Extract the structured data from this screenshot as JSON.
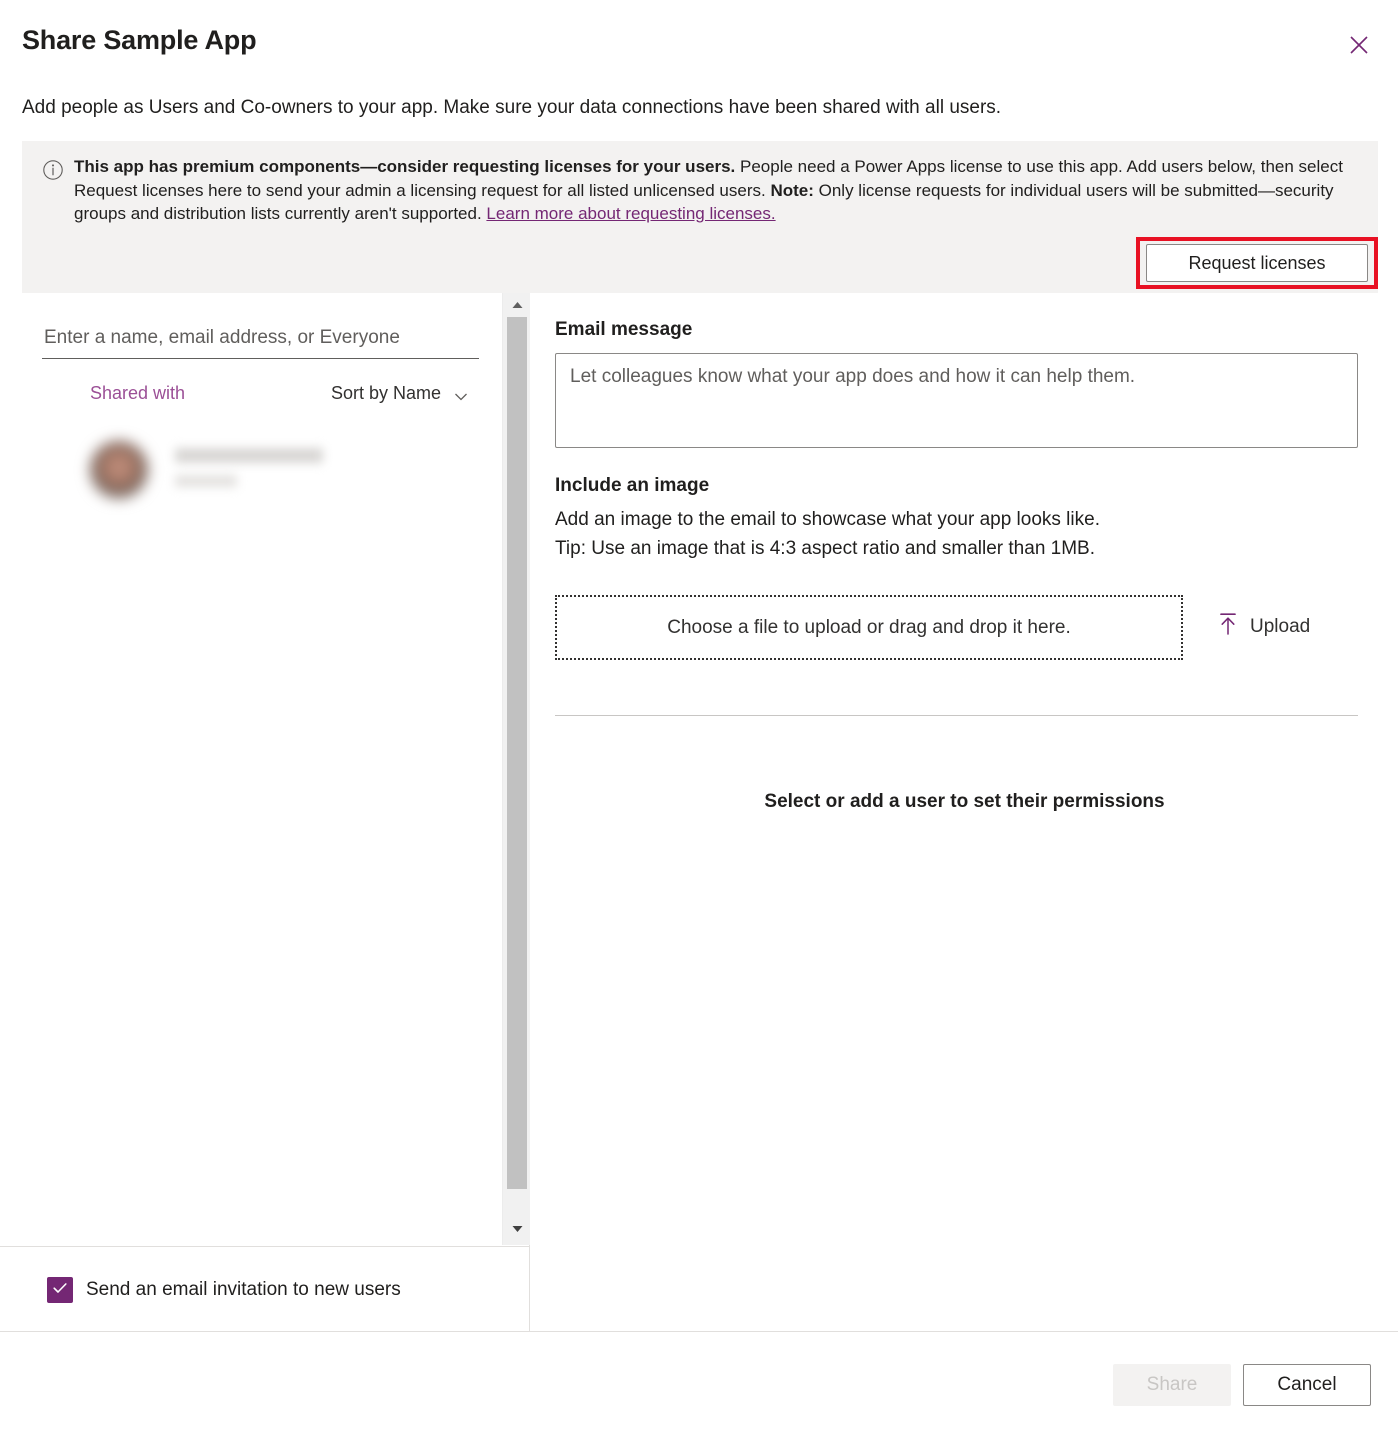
{
  "dialog": {
    "title": "Share Sample App",
    "subtitle": "Add people as Users and Co-owners to your app. Make sure your data connections have been shared with all users.",
    "close_icon": "close-icon",
    "accent_color": "#742774",
    "highlight_color": "#e81123"
  },
  "banner": {
    "icon": "info-icon",
    "bold_lead": "This app has premium components—consider requesting licenses for your users.",
    "body_part1": " People need a Power Apps license to use this app. Add users below, then select Request licenses here to send your admin a licensing request for all listed unlicensed users. ",
    "note_bold": "Note:",
    "body_part2": " Only license requests for individual users will be submitted—security groups and distribution lists currently aren't supported. ",
    "link_text": "Learn more about requesting licenses.",
    "request_button": "Request licenses"
  },
  "left_pane": {
    "people_input_placeholder": "Enter a name, email address, or Everyone",
    "people_input_value": "",
    "shared_with_label": "Shared with",
    "sort_label": "Sort by Name",
    "sort_chevron_icon": "chevron-down-icon",
    "users": [
      {
        "name": "",
        "subtitle": "",
        "redacted": true
      }
    ],
    "scrollbar": {
      "up_arrow_icon": "caret-up-icon",
      "down_arrow_icon": "caret-down-icon"
    },
    "checkbox": {
      "label": "Send an email invitation to new users",
      "checked": true,
      "check_icon": "check-icon"
    }
  },
  "right_pane": {
    "email_message_label": "Email message",
    "email_message_placeholder": "Let colleagues know what your app does and how it can help them.",
    "email_message_value": "",
    "include_image_label": "Include an image",
    "include_image_desc_line1": "Add an image to the email to showcase what your app looks like.",
    "include_image_desc_line2": "Tip: Use an image that is 4:3 aspect ratio and smaller than 1MB.",
    "dropzone_text": "Choose a file to upload or drag and drop it here.",
    "upload_label": "Upload",
    "upload_icon": "upload-arrow-icon",
    "permissions_message": "Select or add a user to set their permissions"
  },
  "footer": {
    "share_label": "Share",
    "share_disabled": true,
    "cancel_label": "Cancel"
  }
}
